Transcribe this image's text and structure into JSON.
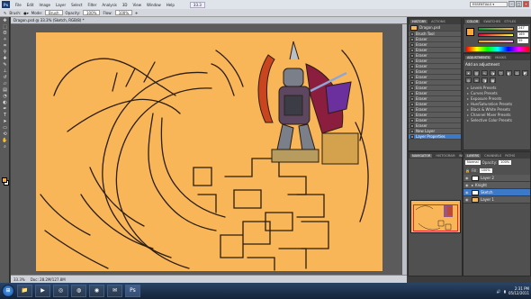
{
  "menubar": {
    "logo": "Ps",
    "items": [
      "File",
      "Edit",
      "Image",
      "Layer",
      "Select",
      "Filter",
      "Analysis",
      "3D",
      "View",
      "Window",
      "Help"
    ],
    "zoom": "33.3",
    "workspace": "ESSENTIALS ▾"
  },
  "options": {
    "brush_label": "Brush:",
    "mode_label": "Mode:",
    "mode_value": "Brush",
    "opacity_label": "Opacity:",
    "opacity_value": "100%",
    "flow_label": "Flow:",
    "flow_value": "100%"
  },
  "document": {
    "tab_title": "Dragon.psd @ 33.3% (Sketch, RGB/8) *",
    "status_zoom": "33.3%",
    "status_doc": "Doc: 28.2M/127.8M"
  },
  "history_panel": {
    "tabs": [
      "HISTORY",
      "ACTIONS"
    ],
    "snapshot": "Dragon.psd",
    "items": [
      "Brush Tool",
      "Eraser",
      "Eraser",
      "Eraser",
      "Eraser",
      "Eraser",
      "Eraser",
      "Eraser",
      "Eraser",
      "Eraser",
      "Eraser",
      "Eraser",
      "Eraser",
      "Eraser",
      "Eraser",
      "Eraser",
      "Eraser",
      "Eraser",
      "New Layer",
      "Layer Properties"
    ]
  },
  "color_panel": {
    "tabs": [
      "COLOR",
      "SWATCHES",
      "STYLES"
    ],
    "rgb": [
      {
        "ch": "R",
        "value": "247"
      },
      {
        "ch": "G",
        "value": "169"
      },
      {
        "ch": "B",
        "value": "59"
      }
    ],
    "fg": "#f7a93b"
  },
  "adjust_panel": {
    "tabs": [
      "ADJUSTMENTS",
      "MASKS"
    ],
    "title": "Add an adjustment",
    "presets": [
      "Levels Presets",
      "Curves Presets",
      "Exposure Presets",
      "Hue/Saturation Presets",
      "Black & White Presets",
      "Channel Mixer Presets",
      "Selective Color Presets"
    ]
  },
  "navigator_panel": {
    "tabs": [
      "NAVIGATOR",
      "HISTOGRAM",
      "INFO"
    ]
  },
  "layers_panel": {
    "tabs": [
      "LAYERS",
      "CHANNELS",
      "PATHS"
    ],
    "mode": "Normal",
    "opacity_label": "Opacity:",
    "opacity": "100%",
    "fill_label": "Fill:",
    "fill": "100%",
    "layers": [
      {
        "name": "Layer 2",
        "type": "layer"
      },
      {
        "name": "Knight",
        "type": "group"
      },
      {
        "name": "Sketch",
        "type": "layer"
      },
      {
        "name": "Layer 1",
        "type": "layer"
      }
    ]
  },
  "taskbar": {
    "time": "2:31 PM",
    "date": "05/12/2011"
  },
  "colors": {
    "canvas": "#f9b659",
    "selection": "#3d79c9",
    "accent": "#f7a93b"
  }
}
